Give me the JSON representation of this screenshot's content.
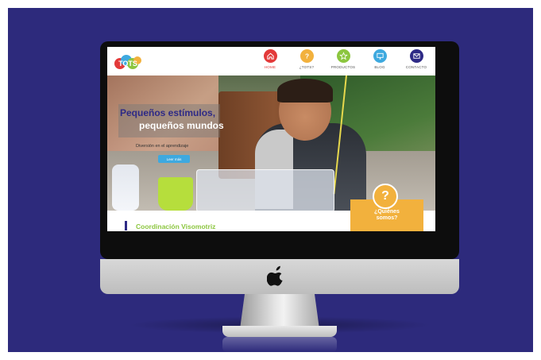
{
  "site": {
    "logo_text": "TOTS",
    "nav": [
      {
        "label": "HOME",
        "icon": "home-icon",
        "color": "#e33a3a",
        "active": true
      },
      {
        "label": "¿TOTS?",
        "icon": "question-icon",
        "color": "#f2b13d",
        "active": false
      },
      {
        "label": "PRODUCTOS",
        "icon": "star-icon",
        "color": "#8cc63f",
        "active": false
      },
      {
        "label": "BLOG",
        "icon": "monitor-icon",
        "color": "#3ea9df",
        "active": false
      },
      {
        "label": "CONTACTO",
        "icon": "mail-icon",
        "color": "#2e2a86",
        "active": false
      }
    ]
  },
  "hero": {
    "title_line1": "Pequeños estímulos,",
    "title_line2": "pequeños mundos",
    "subtitle": "Diversión en el aprendizaje",
    "button_label": "Leer más"
  },
  "footer_strip": {
    "text": "Coordinación Visomotriz"
  },
  "card": {
    "icon_glyph": "?",
    "line1": "¿Quiénes",
    "line2": "somos?"
  },
  "colors": {
    "background": "#2d2a7c",
    "accent_red": "#e33a3a",
    "accent_yellow": "#f2b13d",
    "accent_green": "#8cc63f",
    "accent_blue": "#3ea9df",
    "accent_navy": "#2e2a86"
  }
}
